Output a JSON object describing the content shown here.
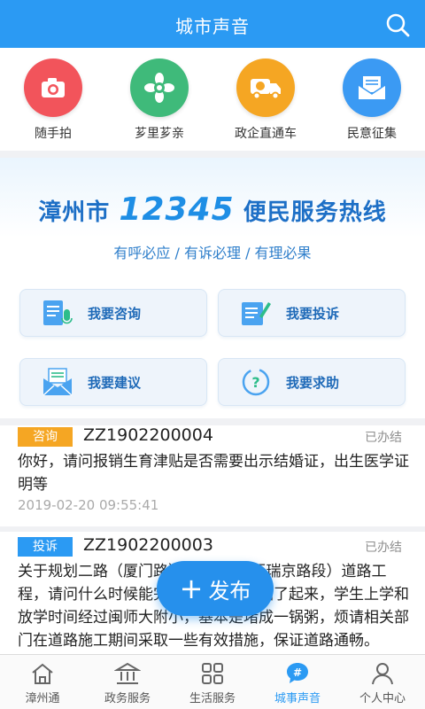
{
  "header": {
    "title": "城市声音"
  },
  "quick": [
    {
      "label": "随手拍",
      "icon": "camera-icon",
      "color": "#f2545b"
    },
    {
      "label": "芗里芗亲",
      "icon": "flower-icon",
      "color": "#3fba7a"
    },
    {
      "label": "政企直通车",
      "icon": "truck-icon",
      "color": "#f5a623"
    },
    {
      "label": "民意征集",
      "icon": "mail-icon",
      "color": "#3b9af3"
    }
  ],
  "banner": {
    "prefix": "漳州市",
    "number": "12345",
    "suffix": "便民服务热线",
    "slogan": "有呼必应 / 有诉必理 / 有理必果"
  },
  "services": [
    {
      "label": "我要咨询",
      "icon": "consult-icon"
    },
    {
      "label": "我要投诉",
      "icon": "complaint-icon"
    },
    {
      "label": "我要建议",
      "icon": "suggestion-icon"
    },
    {
      "label": "我要求助",
      "icon": "help-icon"
    }
  ],
  "list": [
    {
      "tag": "咨询",
      "tag_color": "#f5a623",
      "code": "ZZ1902200004",
      "status": "已办结",
      "body": "你好，请问报销生育津贴是否需要出示结婚证，出生医学证明等",
      "time": "2019-02-20 09:55:41"
    },
    {
      "tag": "投诉",
      "tag_color": "#2b9af3",
      "code": "ZZ1902200003",
      "status": "已办结",
      "body": "关于规划二路（厦门路）、规划三路至瑞京路段）道路工程，请问什么时候能完工？目前铁皮围了起来，学生上学和放学时间经过闽师大附小，基本是堵成一锅粥，烦请相关部门在道路施工期间采取一些有效措施，保证道路通畅。"
    }
  ],
  "fab": {
    "plus": "+",
    "label": "发布"
  },
  "nav": [
    {
      "label": "漳州通",
      "icon": "home-icon",
      "active": false
    },
    {
      "label": "政务服务",
      "icon": "government-icon",
      "active": false
    },
    {
      "label": "生活服务",
      "icon": "grid-icon",
      "active": false
    },
    {
      "label": "城事声音",
      "icon": "hashtag-chat-icon",
      "active": true
    },
    {
      "label": "个人中心",
      "icon": "user-icon",
      "active": false
    }
  ],
  "colors": {
    "primary": "#2b9af3",
    "consult_tag": "#f5a623",
    "complaint_tag": "#2b9af3"
  }
}
